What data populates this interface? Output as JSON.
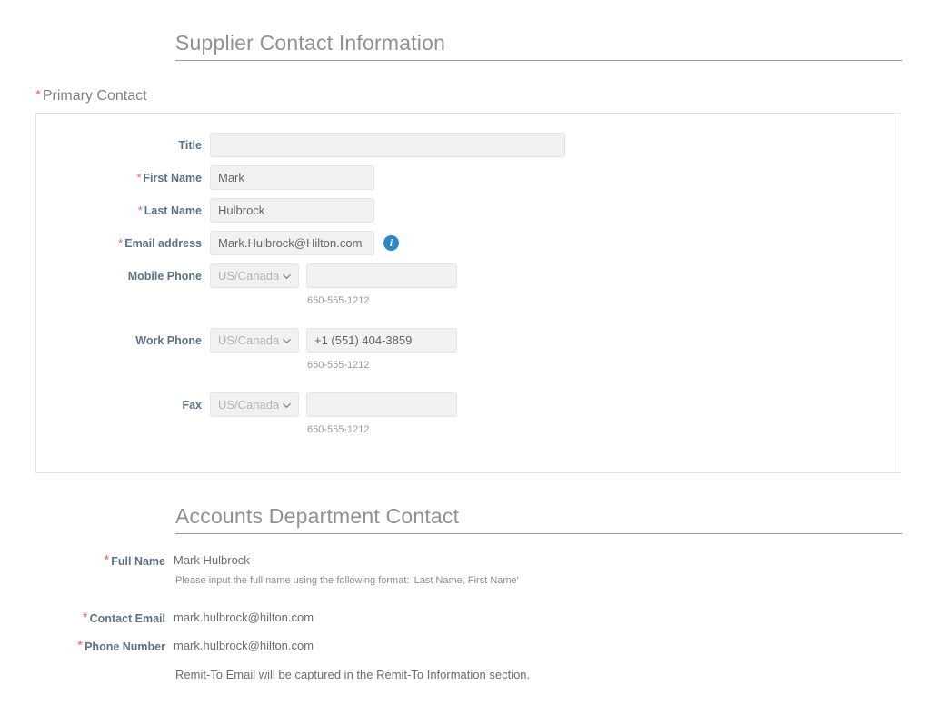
{
  "page": {
    "supplier_section_title": "Supplier Contact Information",
    "accounts_section_title": "Accounts Department Contact"
  },
  "primary_contact": {
    "group_label": "Primary Contact",
    "required_marker": "*",
    "fields": {
      "title": {
        "label": "Title",
        "value": "",
        "placeholder": ""
      },
      "first_name": {
        "label": "First Name",
        "value": "Mark",
        "placeholder": ""
      },
      "last_name": {
        "label": "Last Name",
        "value": "Hulbrock",
        "placeholder": ""
      },
      "email_address": {
        "label": "Email address",
        "value": "Mark.Hulbrock@Hilton.com",
        "placeholder": "",
        "info_icon": "info-icon",
        "info_icon_glyph": "i"
      },
      "mobile_phone": {
        "label": "Mobile Phone",
        "country": "US/Canada",
        "value": "",
        "placeholder": "",
        "hint": "650-555-1212"
      },
      "work_phone": {
        "label": "Work Phone",
        "country": "US/Canada",
        "value": "+1 (551) 404-3859",
        "placeholder": "",
        "hint": "650-555-1212"
      },
      "fax": {
        "label": "Fax",
        "country": "US/Canada",
        "value": "",
        "placeholder": "",
        "hint": "650-555-1212"
      }
    }
  },
  "accounts_department": {
    "full_name": {
      "label": "Full Name",
      "value": "Mark Hulbrock",
      "help": "Please input the full name using the following format: 'Last Name, First Name'"
    },
    "contact_email": {
      "label": "Contact Email",
      "value": "mark.hulbrock@hilton.com"
    },
    "phone_number": {
      "label": "Phone Number",
      "value": "mark.hulbrock@hilton.com"
    },
    "note": "Remit-To Email will be captured in the Remit-To Information section."
  },
  "colors": {
    "heading_text": "#8e9195",
    "label_text": "#5c7184",
    "required_star": "#e8606a",
    "input_background": "#f1f1f1",
    "input_border": "#e4e4e4",
    "info_icon_background": "#2c87c9",
    "panel_border": "#e2e2e2",
    "hint_text": "#9b9b9b"
  }
}
